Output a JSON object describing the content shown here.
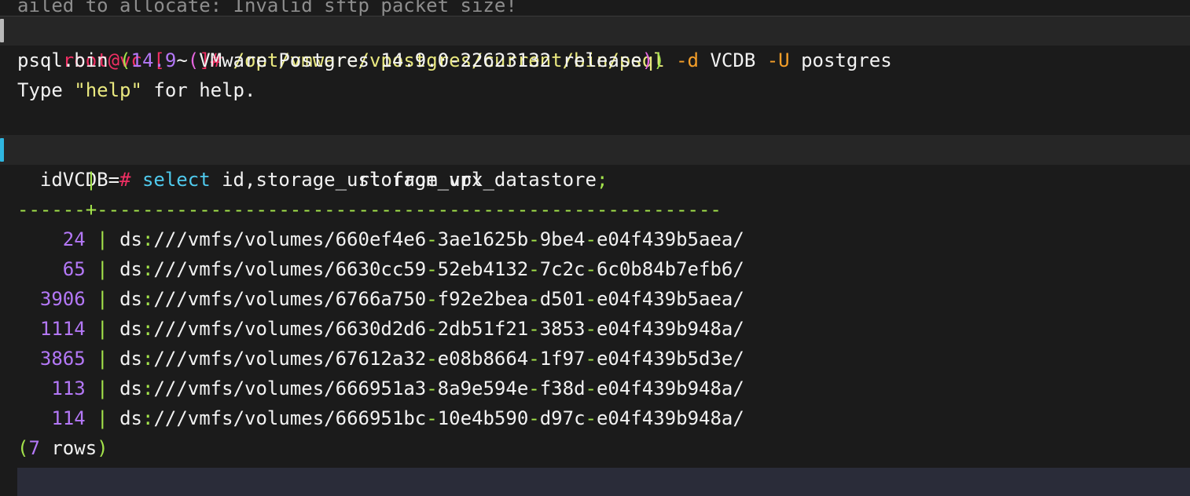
{
  "terminal": {
    "scrollback_clipped_line": "ailed to allocate: Invalid sftp packet size!",
    "prompt": {
      "user_host": "root@vc",
      "bracket_open": "[",
      "cwd": "~",
      "bracket_close_hash": "]#",
      "command_path": "/opt/vmware/vpostgres/current/bin/psql",
      "flag_d": "-d",
      "db_name": "VCDB",
      "flag_u": "-U",
      "db_user": "postgres"
    },
    "psql_banner": {
      "binary": "psql.bin",
      "paren_open_outer": "(",
      "client_version": "14.9",
      "paren_open_inner": "(",
      "server_text": "VMware Postgres 14.9.0-22623132 release",
      "paren_close_inner": ")",
      "paren_close_outer": ")",
      "help_line_prefix": "Type ",
      "help_quoted": "\"help\"",
      "help_line_suffix": " for help."
    },
    "query_line": {
      "db_prompt": "VCDB=",
      "prompt_hash": "#",
      "keyword_select": "select",
      "columns": " id,storage_url ",
      "keyword_from": "from",
      "table": " vpx_datastore",
      "semicolon": ";"
    },
    "result": {
      "header": {
        "col_id": "id",
        "pipe": "|",
        "col_storage_url": "storage_url"
      },
      "separator_left": "------",
      "separator_plus": "+",
      "separator_right": "-------------------------------------------------------",
      "rows": [
        {
          "id": "24",
          "scheme": "ds",
          "colon": ":",
          "path": "///vmfs/volumes/",
          "uuid_parts": [
            "660ef4e6",
            "3ae1625b",
            "9be4",
            "e04f439b5aea"
          ],
          "trailing": "/"
        },
        {
          "id": "65",
          "scheme": "ds",
          "colon": ":",
          "path": "///vmfs/volumes/",
          "uuid_parts": [
            "6630cc59",
            "52eb4132",
            "7c2c",
            "6c0b84b7efb6"
          ],
          "trailing": "/"
        },
        {
          "id": "3906",
          "scheme": "ds",
          "colon": ":",
          "path": "///vmfs/volumes/",
          "uuid_parts": [
            "6766a750",
            "f92e2bea",
            "d501",
            "e04f439b5aea"
          ],
          "trailing": "/"
        },
        {
          "id": "1114",
          "scheme": "ds",
          "colon": ":",
          "path": "///vmfs/volumes/",
          "uuid_parts": [
            "6630d2d6",
            "2db51f21",
            "3853",
            "e04f439b948a"
          ],
          "trailing": "/"
        },
        {
          "id": "3865",
          "scheme": "ds",
          "colon": ":",
          "path": "///vmfs/volumes/",
          "uuid_parts": [
            "67612a32",
            "e08b8664",
            "1f97",
            "e04f439b5d3e"
          ],
          "trailing": "/"
        },
        {
          "id": "113",
          "scheme": "ds",
          "colon": ":",
          "path": "///vmfs/volumes/",
          "uuid_parts": [
            "666951a3",
            "8a9e594e",
            "f38d",
            "e04f439b948a"
          ],
          "trailing": "/"
        },
        {
          "id": "114",
          "scheme": "ds",
          "colon": ":",
          "path": "///vmfs/volumes/",
          "uuid_parts": [
            "666951bc",
            "10e4b590",
            "d97c",
            "e04f439b948a"
          ],
          "trailing": "/"
        }
      ],
      "row_count": {
        "paren_open": "(",
        "count": "7",
        "label": " rows",
        "paren_close": ")"
      }
    },
    "colors": {
      "background": "#1b1b1b",
      "command_row_background": "#262626",
      "bottom_band": "#2a2c39",
      "marker_gray": "#b9b9b9",
      "marker_blue": "#2fb6e0",
      "pink": "#ef2f63",
      "yellow": "#e9e87f",
      "orange": "#f59f29",
      "green": "#a4e44b",
      "purple": "#b478f7",
      "magenta": "#e666e0",
      "cyan": "#4fc9ec",
      "text": "#f2f2f2"
    }
  }
}
